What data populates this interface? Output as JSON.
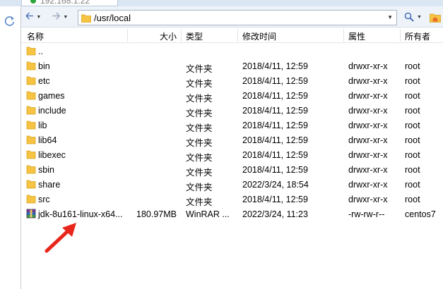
{
  "tab": {
    "label": "192.168.1.22"
  },
  "toolbar": {
    "path": "/usr/local",
    "icons": [
      "back-arrow-icon",
      "forward-arrow-icon",
      "folder-icon",
      "search-icon",
      "home-folder-icon"
    ]
  },
  "columns": {
    "name": "名称",
    "size": "大小",
    "type": "类型",
    "modified": "修改时间",
    "permissions": "属性",
    "owner": "所有者"
  },
  "files": [
    {
      "name": "..",
      "size": "",
      "type": "",
      "modified": "",
      "permissions": "",
      "owner": "",
      "kind": "folder"
    },
    {
      "name": "bin",
      "size": "",
      "type": "文件夹",
      "modified": "2018/4/11, 12:59",
      "permissions": "drwxr-xr-x",
      "owner": "root",
      "kind": "folder"
    },
    {
      "name": "etc",
      "size": "",
      "type": "文件夹",
      "modified": "2018/4/11, 12:59",
      "permissions": "drwxr-xr-x",
      "owner": "root",
      "kind": "folder"
    },
    {
      "name": "games",
      "size": "",
      "type": "文件夹",
      "modified": "2018/4/11, 12:59",
      "permissions": "drwxr-xr-x",
      "owner": "root",
      "kind": "folder"
    },
    {
      "name": "include",
      "size": "",
      "type": "文件夹",
      "modified": "2018/4/11, 12:59",
      "permissions": "drwxr-xr-x",
      "owner": "root",
      "kind": "folder"
    },
    {
      "name": "lib",
      "size": "",
      "type": "文件夹",
      "modified": "2018/4/11, 12:59",
      "permissions": "drwxr-xr-x",
      "owner": "root",
      "kind": "folder"
    },
    {
      "name": "lib64",
      "size": "",
      "type": "文件夹",
      "modified": "2018/4/11, 12:59",
      "permissions": "drwxr-xr-x",
      "owner": "root",
      "kind": "folder"
    },
    {
      "name": "libexec",
      "size": "",
      "type": "文件夹",
      "modified": "2018/4/11, 12:59",
      "permissions": "drwxr-xr-x",
      "owner": "root",
      "kind": "folder"
    },
    {
      "name": "sbin",
      "size": "",
      "type": "文件夹",
      "modified": "2018/4/11, 12:59",
      "permissions": "drwxr-xr-x",
      "owner": "root",
      "kind": "folder"
    },
    {
      "name": "share",
      "size": "",
      "type": "文件夹",
      "modified": "2022/3/24, 18:54",
      "permissions": "drwxr-xr-x",
      "owner": "root",
      "kind": "folder"
    },
    {
      "name": "src",
      "size": "",
      "type": "文件夹",
      "modified": "2018/4/11, 12:59",
      "permissions": "drwxr-xr-x",
      "owner": "root",
      "kind": "folder"
    },
    {
      "name": "jdk-8u161-linux-x64...",
      "size": "180.97MB",
      "type": "WinRAR ...",
      "modified": "2022/3/24, 11:23",
      "permissions": "-rw-rw-r--",
      "owner": "centos7",
      "kind": "archive"
    }
  ],
  "colors": {
    "folder": "#f6c342",
    "annotation_arrow": "#e8261b",
    "archive_purple": "#7a3d98"
  }
}
